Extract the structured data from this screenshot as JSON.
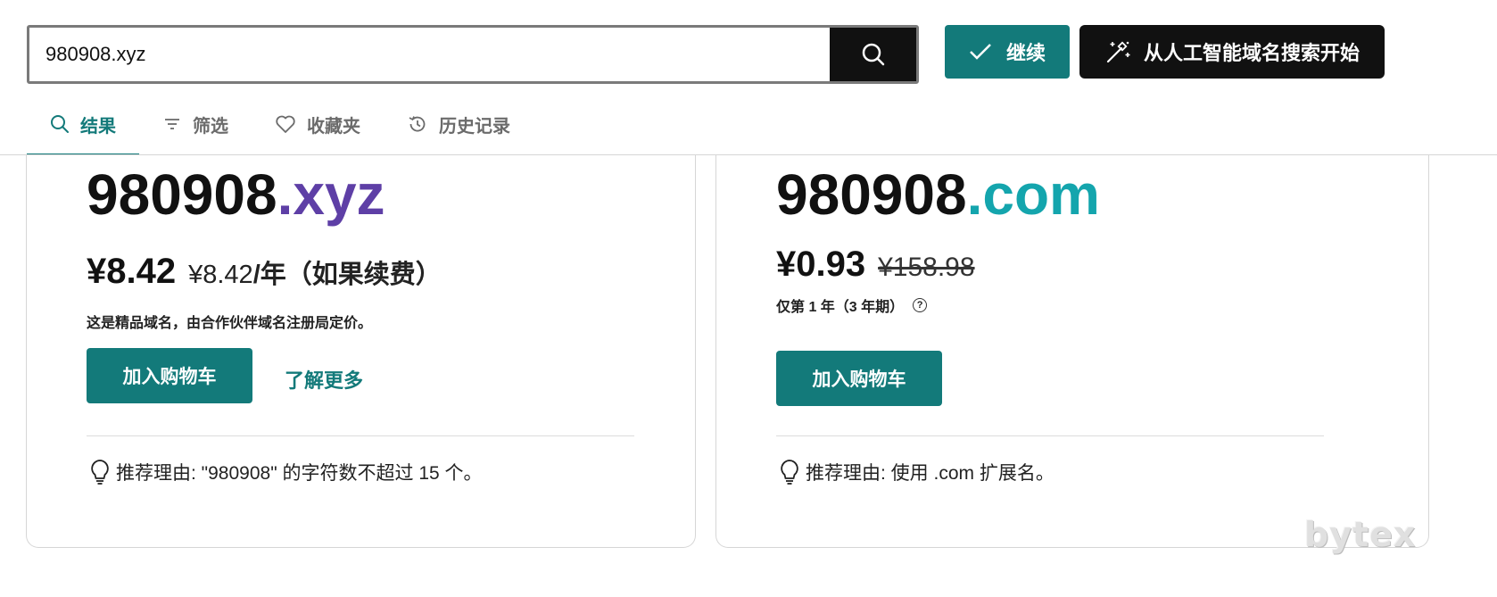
{
  "search": {
    "value": "980908.xyz"
  },
  "header": {
    "continue_label": "继续",
    "ai_label": "从人工智能域名搜索开始"
  },
  "tabs": [
    {
      "label": "结果",
      "icon": "search-icon",
      "active": true
    },
    {
      "label": "筛选",
      "icon": "filter-icon",
      "active": false
    },
    {
      "label": "收藏夹",
      "icon": "heart-icon",
      "active": false
    },
    {
      "label": "历史记录",
      "icon": "history-icon",
      "active": false
    }
  ],
  "cards": [
    {
      "domain_base": "980908",
      "domain_tld": ".xyz",
      "tld_color": "#5e3fa6",
      "price": "¥8.42",
      "renewal_price": "¥8.42",
      "renewal_suffix": "/年（如果续费）",
      "note": "这是精品域名，由合作伙伴域名注册局定价。",
      "cart_label": "加入购物车",
      "learn_more_label": "了解更多",
      "reason": "推荐理由: \"980908\" 的字符数不超过 15 个。"
    },
    {
      "domain_base": "980908",
      "domain_tld": ".com",
      "tld_color": "#14a5ad",
      "price": "¥0.93",
      "old_price": "¥158.98",
      "note": "仅第 1 年（3 年期）",
      "cart_label": "加入购物车",
      "reason": "推荐理由: 使用 .com 扩展名。"
    }
  ],
  "watermark": "bytex",
  "colors": {
    "accent": "#137a7a",
    "dark": "#111111"
  }
}
